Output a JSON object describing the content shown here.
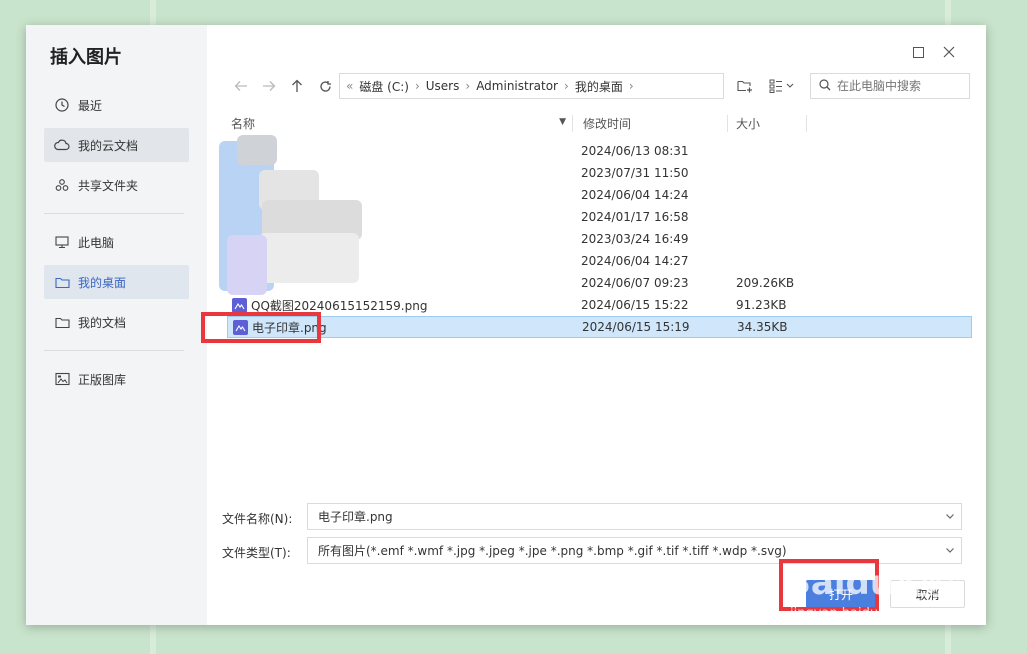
{
  "dialog": {
    "title": "插入图片",
    "window_controls": {
      "maximize_icon": "maximize-icon",
      "close_icon": "close-icon"
    }
  },
  "sidebar": {
    "items": [
      {
        "label": "最近",
        "icon": "clock-icon"
      },
      {
        "label": "我的云文档",
        "icon": "cloud-icon"
      },
      {
        "label": "共享文件夹",
        "icon": "share-icon"
      },
      {
        "label": "此电脑",
        "icon": "monitor-icon"
      },
      {
        "label": "我的桌面",
        "icon": "folder-icon"
      },
      {
        "label": "我的文档",
        "icon": "folder-icon"
      },
      {
        "label": "正版图库",
        "icon": "gallery-icon"
      }
    ]
  },
  "address_bar": {
    "crumbs": [
      "磁盘 (C:)",
      "Users",
      "Administrator",
      "我的桌面"
    ]
  },
  "search": {
    "placeholder": "在此电脑中搜索"
  },
  "columns": {
    "name": "名称",
    "date": "修改时间",
    "size": "大小"
  },
  "files": [
    {
      "name": "",
      "date": "2024/06/13 08:31",
      "size": ""
    },
    {
      "name": "",
      "date": "2023/07/31 11:50",
      "size": ""
    },
    {
      "name": "",
      "date": "2024/06/04 14:24",
      "size": ""
    },
    {
      "name": "",
      "date": "2024/01/17 16:58",
      "size": ""
    },
    {
      "name": "",
      "date": "2023/03/24 16:49",
      "size": ""
    },
    {
      "name": "",
      "date": "2024/06/04 14:27",
      "size": ""
    },
    {
      "name": "",
      "date": "2024/06/07 09:23",
      "size": "209.26KB"
    },
    {
      "name": "QQ截图20240615152159.png",
      "date": "2024/06/15 15:22",
      "size": "91.23KB"
    },
    {
      "name": "电子印章.png",
      "date": "2024/06/15 15:19",
      "size": "34.35KB"
    }
  ],
  "form": {
    "filename_label": "文件名称(N):",
    "filename_value": "电子印章.png",
    "filetype_label": "文件类型(T):",
    "filetype_value": "所有图片(*.emf *.wmf *.jpg *.jpeg *.jpe *.png *.bmp *.gif *.tif *.tiff *.wdp *.svg)"
  },
  "buttons": {
    "open": "打开",
    "cancel": "取消"
  },
  "watermark": {
    "main": "Baidu经验",
    "sub": "jingyan.baidu.com"
  },
  "colors": {
    "accent": "#4a7fe0",
    "selection": "#cfe6fb",
    "highlight_box": "#e8383d",
    "background": "#c9e4cc"
  }
}
